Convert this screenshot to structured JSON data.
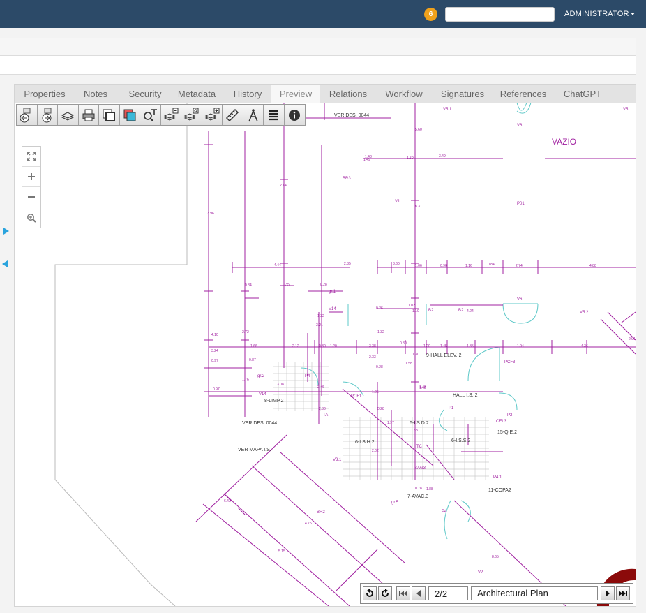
{
  "header": {
    "notifications_count": "6",
    "search_value": "",
    "user_label": "ADMINISTRATOR"
  },
  "tabs": [
    {
      "label": "Properties"
    },
    {
      "label": "Notes"
    },
    {
      "label": "Security"
    },
    {
      "label": "Metadata"
    },
    {
      "label": "History"
    },
    {
      "label": "Preview",
      "active": true
    },
    {
      "label": "Relations"
    },
    {
      "label": "Workflow"
    },
    {
      "label": "Signatures"
    },
    {
      "label": "References"
    },
    {
      "label": "ChatGPT"
    }
  ],
  "viewer_toolbar": {
    "icons": [
      "prev-document-icon",
      "next-document-icon",
      "layers-icon",
      "print-icon",
      "window-icon",
      "overlay-icon",
      "text-search-icon",
      "layer-remove-icon",
      "layer-settings-icon",
      "layer-add-icon",
      "ruler-icon",
      "compass-icon",
      "list-icon",
      "info-icon"
    ]
  },
  "zoom_controls": {
    "icons": [
      "fit-screen-icon",
      "zoom-in-icon",
      "zoom-out-icon",
      "zoom-reset-icon"
    ]
  },
  "pager": {
    "page_value": "2/2",
    "document_name": "Architectural Plan"
  },
  "drawing": {
    "colors": {
      "primary": "#a020a0",
      "secondary": "#40c0c0"
    },
    "labels": {
      "vazio": "VAZIO",
      "ver_des_top": "VER DES. 0044",
      "v5_1": "V5.1",
      "v5": "V5",
      "v6_top": "V6",
      "br3": "BR3",
      "v1": "V1",
      "p01": "P01",
      "v14": "V14",
      "v6": "V6",
      "v5_2": "V5.2",
      "gr1": "gr.1",
      "gr2": "gr.2",
      "pcf3": "PCF3",
      "hall_elev": "9-HALL ELEV. 2",
      "hall_is": "HALL I.S. 2",
      "limp": "8-LIMP.2",
      "ver_des_bottom": "VER DES. 0044",
      "pcf1": "PCF1",
      "isd": "6-I.S.D.2",
      "ish": "6-I.S.H.2",
      "iss": "6-I.S.S.2",
      "qe": "15-Q.E.2",
      "cel3": "CEL3",
      "p1": "P1",
      "p2": "P2",
      "p4_top": "P4",
      "ver_mapa": "VER MAPA I.S.",
      "v3_1": "V3.1",
      "sag3": "SAG3",
      "copa": "11-COPA2",
      "avac": "7-AVAC.3",
      "p4_1": "P4.1",
      "br2": "BR2",
      "p4": "P4",
      "v2": "V2",
      "ta": "TA",
      "tc": "TC",
      "gr5": "gr.5",
      "b2": "B2",
      "dims": [
        "1.48",
        "1.49",
        "1.59",
        "3.49",
        "4.44",
        "2.35",
        "3.60",
        "1.06",
        "0.90",
        "1.16",
        "0.84",
        "2.74",
        "4.88",
        "0.34",
        "0.35",
        "0.28",
        "1.32",
        "0.26",
        "1.02",
        "2.12",
        "1.66",
        "0.30",
        "1.20",
        "3.38",
        "2.33",
        "0.30",
        "1.30",
        "0.28",
        "1.48",
        "1.45",
        "1.35",
        "1.94",
        "4.36",
        "3.24",
        "0.97",
        "0.87",
        "3.08",
        "2.46",
        "1.05",
        "1.48",
        "2.02",
        "1.88",
        "0.78",
        "4.10",
        "3.96",
        "2.44",
        "8.31",
        "5.60",
        "2.72",
        "0.97",
        "1.76",
        "3.21",
        "1.32",
        "1.10",
        "4.24",
        "1.58",
        "2.91",
        "1.20",
        "0.28",
        "2.30",
        "1.97",
        "1.88",
        "6.43",
        "4.75",
        "5.15",
        "8.65"
      ]
    }
  }
}
